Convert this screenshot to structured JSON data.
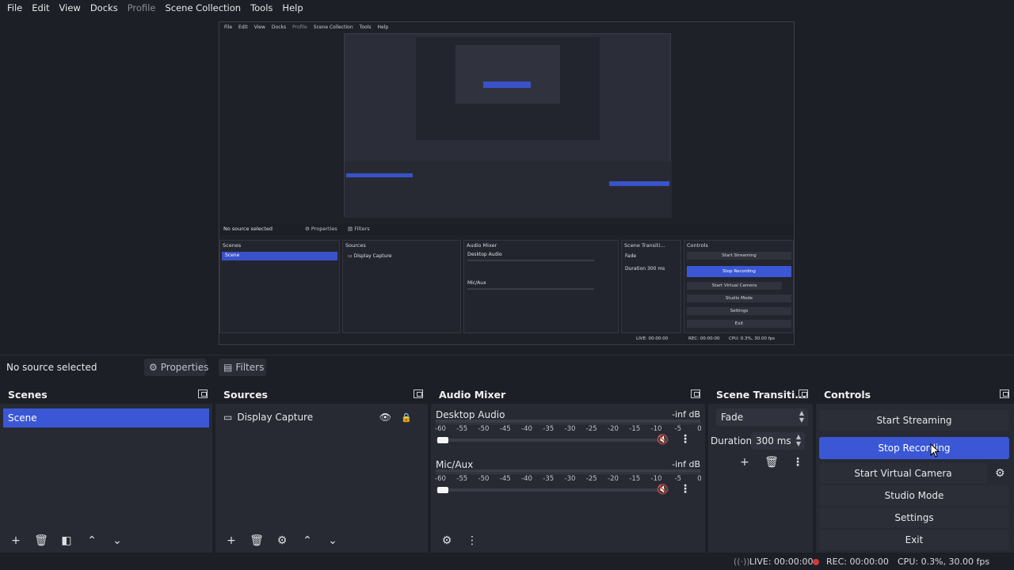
{
  "menu": [
    "File",
    "Edit",
    "View",
    "Docks",
    "Profile",
    "Scene Collection",
    "Tools",
    "Help"
  ],
  "context": {
    "no_source": "No source selected",
    "properties": "Properties",
    "filters": "Filters"
  },
  "scenes": {
    "title": "Scenes",
    "items": [
      "Scene"
    ]
  },
  "sources": {
    "title": "Sources",
    "items": [
      "Display Capture"
    ]
  },
  "mixer": {
    "title": "Audio Mixer",
    "ticks": [
      "-60",
      "-55",
      "-50",
      "-45",
      "-40",
      "-35",
      "-30",
      "-25",
      "-20",
      "-15",
      "-10",
      "-5",
      "0"
    ],
    "channels": [
      {
        "name": "Desktop Audio",
        "db": "-inf dB"
      },
      {
        "name": "Mic/Aux",
        "db": "-inf dB"
      }
    ]
  },
  "transitions": {
    "title": "Scene Transiti...",
    "selected": "Fade",
    "duration_label": "Duration",
    "duration_value": "300 ms"
  },
  "controls": {
    "title": "Controls",
    "start_streaming": "Start Streaming",
    "stop_recording": "Stop Recording",
    "start_virtual_camera": "Start Virtual Camera",
    "studio_mode": "Studio Mode",
    "settings": "Settings",
    "exit": "Exit"
  },
  "status": {
    "live": "LIVE: 00:00:00",
    "rec": "REC: 00:00:00",
    "cpu": "CPU: 0.3%, 30.00 fps"
  },
  "colors": {
    "accent": "#3b57d6",
    "background": "#1d1f26",
    "dock": "#272a33",
    "mute": "#d23a3a"
  }
}
